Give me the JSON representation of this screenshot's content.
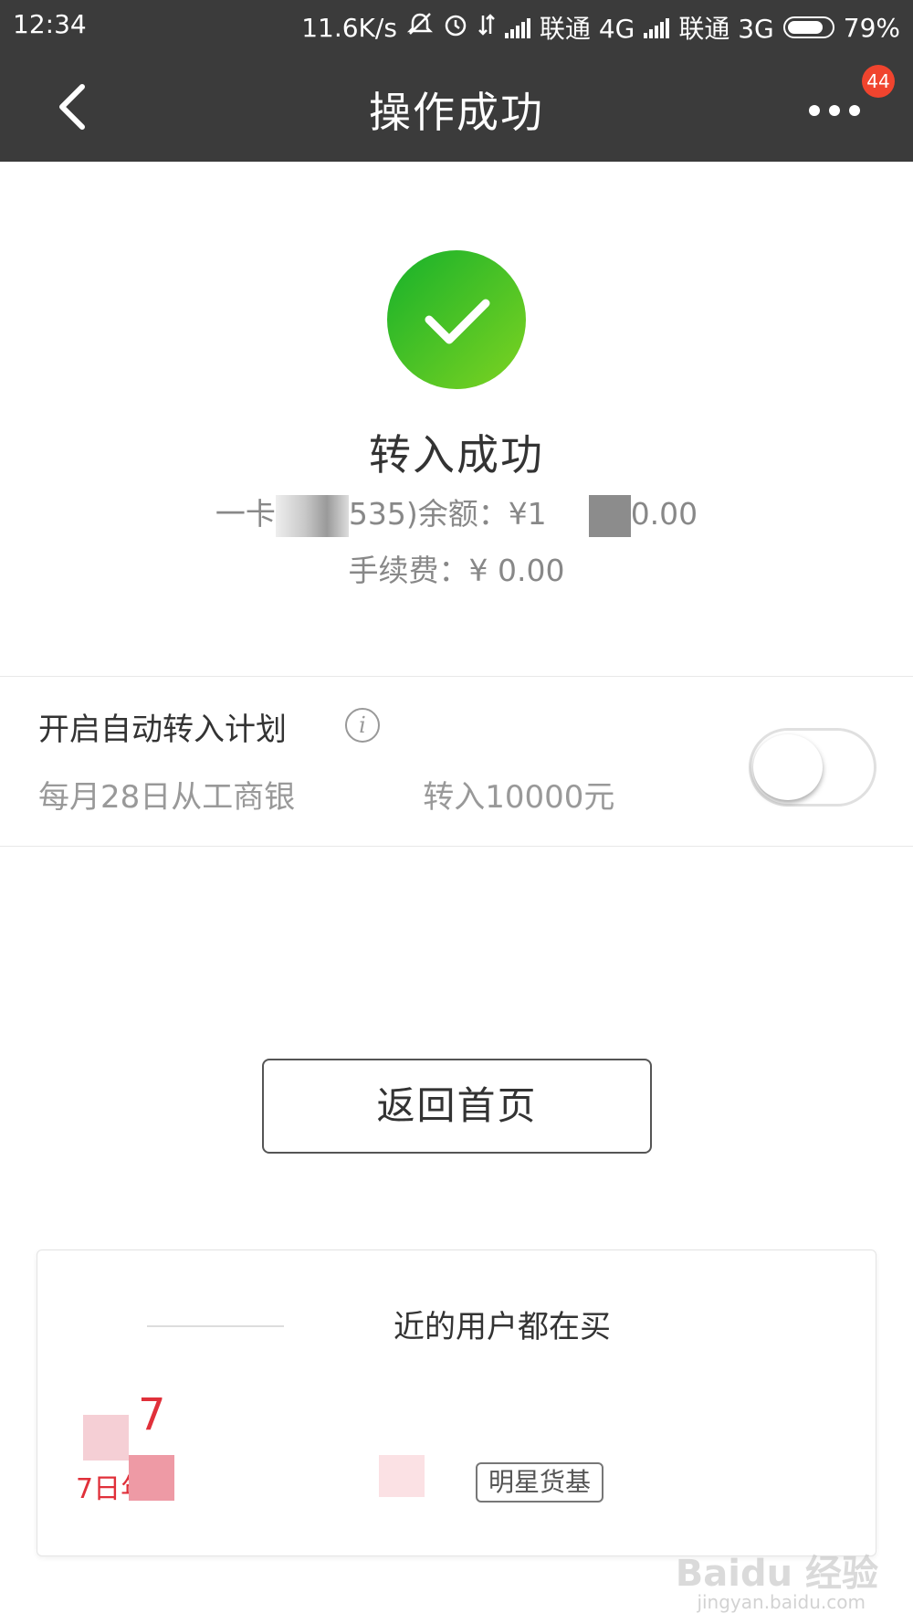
{
  "status_bar": {
    "time": "12:34",
    "speed": "11.6K/s",
    "carrier1": "联通 4G",
    "carrier2": "联通 3G",
    "battery": "79%",
    "icons": [
      "mute-icon",
      "alarm-icon",
      "data-arrows-icon",
      "signal-icon",
      "battery-icon"
    ]
  },
  "header": {
    "title": "操作成功",
    "back_icon": "chevron-left-icon",
    "more_icon": "more-dots-icon",
    "badge_count": "44"
  },
  "result": {
    "icon": "checkmark-circle-icon",
    "title": "转入成功",
    "card_prefix": "一卡",
    "card_middle": "535)余额：¥1",
    "card_suffix": "0.00",
    "fee_line": "手续费：¥ 0.00"
  },
  "auto_transfer": {
    "title": "开启自动转入计划",
    "desc_part1": "每月28日从工商银",
    "desc_part2": "转入10000元",
    "toggle_on": false
  },
  "return_button": {
    "label": "返回首页"
  },
  "recommend": {
    "title": "近的用户都在买",
    "rate_label": "7日年",
    "big_digit": "7",
    "tag": "明星货基"
  },
  "watermark": {
    "main": "Baidu 经验",
    "sub": "jingyan.baidu.com"
  },
  "colors": {
    "header_bg": "#3b3b3b",
    "success_green": "#16b12b",
    "badge_red": "#f0442e",
    "rate_red": "#e0303a"
  }
}
